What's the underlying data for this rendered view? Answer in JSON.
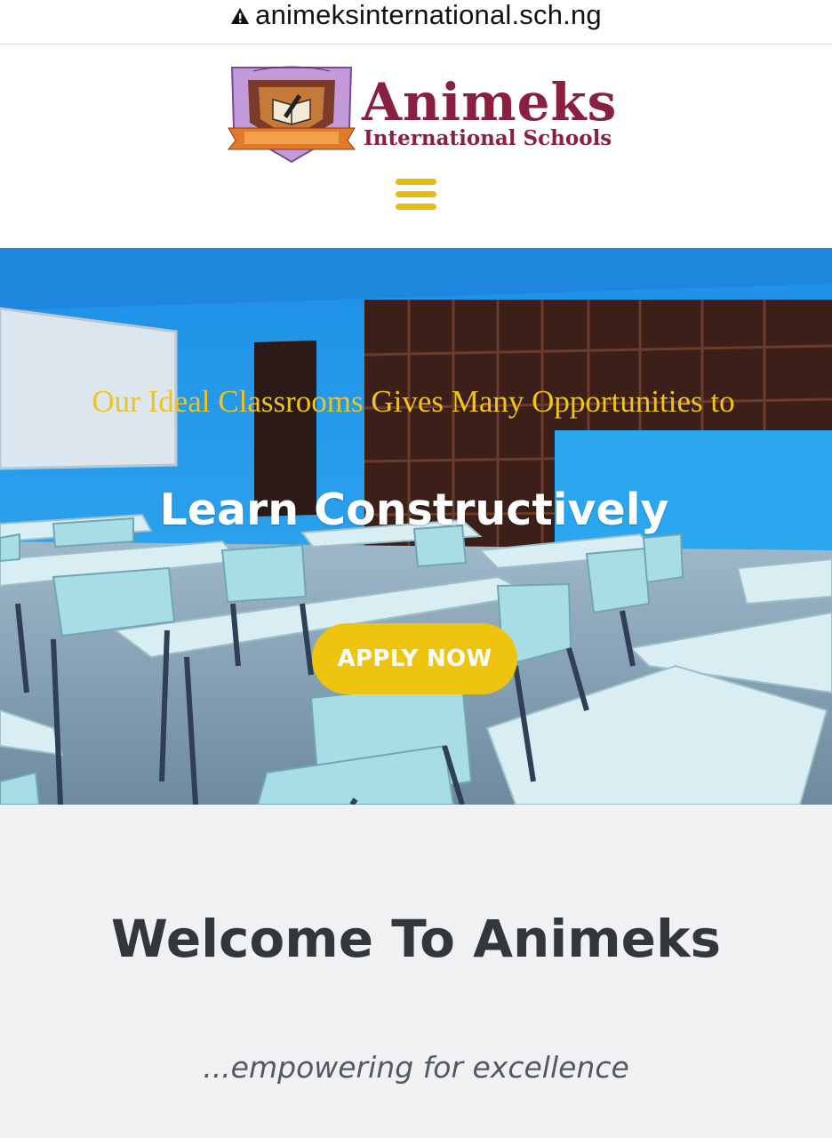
{
  "browser": {
    "url": "animeksinternational.sch.ng",
    "security_icon": "warning-triangle-icon"
  },
  "header": {
    "logo": {
      "name": "Animeks",
      "subtitle": "International Schools",
      "crest_text": "ANIMEKS INTERNATIONAL SCHOOLS",
      "crest_motto": "empowering for excellence"
    },
    "menu_icon": "hamburger-menu-icon",
    "accent_color": "#e6bd0c",
    "brand_color": "#8a2040"
  },
  "hero": {
    "kicker": "Our Ideal Classrooms Gives Many Opportunities to",
    "title": "Learn Constructively",
    "cta_label": "APPLY NOW",
    "background": "classroom-photo"
  },
  "welcome": {
    "title": "Welcome To Animeks",
    "tagline": "...empowering for excellence"
  }
}
